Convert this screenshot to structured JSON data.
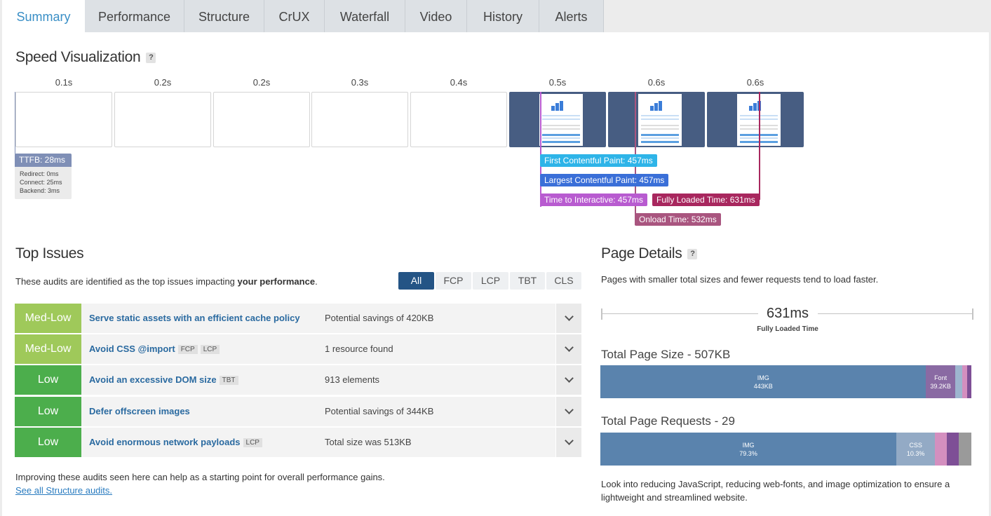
{
  "tabs": [
    {
      "label": "Summary",
      "active": true
    },
    {
      "label": "Performance"
    },
    {
      "label": "Structure"
    },
    {
      "label": "CrUX"
    },
    {
      "label": "Waterfall"
    },
    {
      "label": "Video"
    },
    {
      "label": "History"
    },
    {
      "label": "Alerts"
    }
  ],
  "speed": {
    "title": "Speed Visualization",
    "help": "?",
    "frames": [
      {
        "time": "0.1s",
        "painted": false
      },
      {
        "time": "0.2s",
        "painted": false
      },
      {
        "time": "0.2s",
        "painted": false
      },
      {
        "time": "0.3s",
        "painted": false
      },
      {
        "time": "0.4s",
        "painted": false
      },
      {
        "time": "0.5s",
        "painted": true
      },
      {
        "time": "0.6s",
        "painted": true
      },
      {
        "time": "0.6s",
        "painted": true
      }
    ],
    "ttfb": {
      "label": "TTFB: 28ms",
      "redirect": "Redirect: 0ms",
      "connect": "Connect: 25ms",
      "backend": "Backend: 3ms"
    },
    "markers": {
      "fcp": "First Contentful Paint: 457ms",
      "lcp": "Largest Contentful Paint: 457ms",
      "tti": "Time to Interactive: 457ms",
      "flt": "Fully Loaded Time: 631ms",
      "onload": "Onload Time: 532ms"
    },
    "colors": {
      "fcp": "#2eb4e8",
      "lcp": "#3a6fd8",
      "tti": "#b85bd0",
      "flt": "#a8275e",
      "onload": "#a9557f",
      "ttfb": "#7f8fb6"
    }
  },
  "issues": {
    "title": "Top Issues",
    "intro_pre": "These audits are identified as the top issues impacting ",
    "intro_bold": "your performance",
    "intro_post": ".",
    "filters": [
      "All",
      "FCP",
      "LCP",
      "TBT",
      "CLS"
    ],
    "active_filter": "All",
    "rows": [
      {
        "grade": "Med-Low",
        "title": "Serve static assets with an efficient cache policy",
        "tags": [],
        "savings": "Potential savings of 420KB"
      },
      {
        "grade": "Med-Low",
        "title": "Avoid CSS @import",
        "tags": [
          "FCP",
          "LCP"
        ],
        "savings": "1 resource found"
      },
      {
        "grade": "Low",
        "title": "Avoid an excessive DOM size",
        "tags": [
          "TBT"
        ],
        "savings": "913 elements"
      },
      {
        "grade": "Low",
        "title": "Defer offscreen images",
        "tags": [],
        "savings": "Potential savings of 344KB"
      },
      {
        "grade": "Low",
        "title": "Avoid enormous network payloads",
        "tags": [
          "LCP"
        ],
        "savings": "Total size was 513KB"
      }
    ],
    "footer": "Improving these audits seen here can help as a starting point for overall performance gains.",
    "link": "See all Structure audits."
  },
  "details": {
    "title": "Page Details",
    "help": "?",
    "intro": "Pages with smaller total sizes and fewer requests tend to load faster.",
    "fully_loaded_value": "631ms",
    "fully_loaded_label": "Fully Loaded Time",
    "size_title": "Total Page Size - 507KB",
    "size_segments": [
      {
        "label": "IMG",
        "value": "443KB",
        "fraction": 0.878,
        "color": "#5a83ad"
      },
      {
        "label": "Font",
        "value": "39.2KB",
        "fraction": 0.078,
        "color": "#8a6aa3"
      },
      {
        "label": "",
        "value": "",
        "fraction": 0.02,
        "color": "#9db5cf"
      },
      {
        "label": "",
        "value": "",
        "fraction": 0.013,
        "color": "#d48fbf"
      },
      {
        "label": "",
        "value": "",
        "fraction": 0.011,
        "color": "#7e4f96"
      }
    ],
    "requests_title": "Total Page Requests - 29",
    "request_segments": [
      {
        "label": "IMG",
        "value": "79.3%",
        "fraction": 0.798,
        "color": "#5a83ad"
      },
      {
        "label": "CSS",
        "value": "10.3%",
        "fraction": 0.104,
        "color": "#93aac5"
      },
      {
        "label": "",
        "value": "",
        "fraction": 0.032,
        "color": "#d48fbf"
      },
      {
        "label": "",
        "value": "",
        "fraction": 0.032,
        "color": "#7e4f96"
      },
      {
        "label": "",
        "value": "",
        "fraction": 0.034,
        "color": "#9a9a9a"
      }
    ],
    "footer": "Look into reducing JavaScript, reducing web-fonts, and image optimization to ensure a lightweight and streamlined website."
  }
}
